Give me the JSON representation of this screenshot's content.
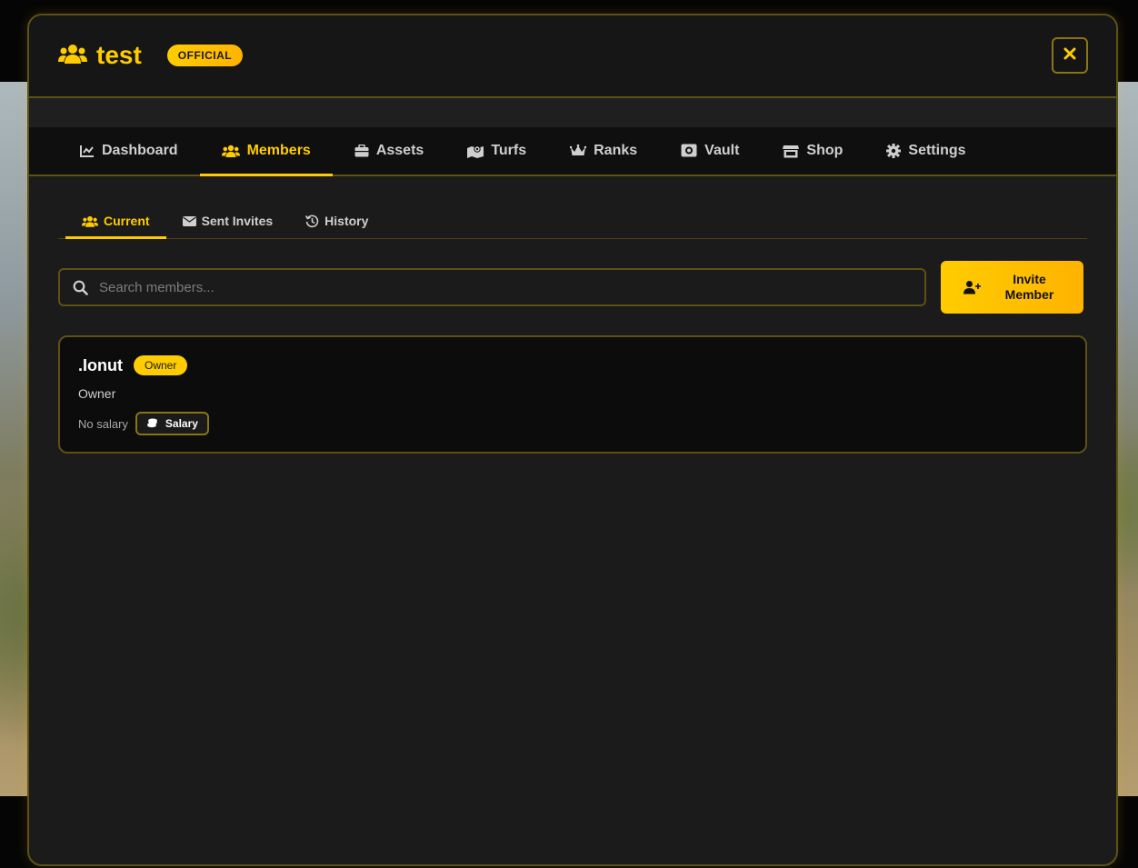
{
  "header": {
    "title": "test",
    "badge": "OFFICIAL",
    "close_label": "✕"
  },
  "tabs": [
    {
      "label": "Dashboard",
      "icon": "chart-line-icon",
      "active": false
    },
    {
      "label": "Members",
      "icon": "users-icon",
      "active": true
    },
    {
      "label": "Assets",
      "icon": "briefcase-icon",
      "active": false
    },
    {
      "label": "Turfs",
      "icon": "map-icon",
      "active": false
    },
    {
      "label": "Ranks",
      "icon": "crown-icon",
      "active": false
    },
    {
      "label": "Vault",
      "icon": "vault-icon",
      "active": false
    },
    {
      "label": "Shop",
      "icon": "store-icon",
      "active": false
    },
    {
      "label": "Settings",
      "icon": "gear-icon",
      "active": false
    }
  ],
  "subtabs": [
    {
      "label": "Current",
      "icon": "users-icon",
      "active": true
    },
    {
      "label": "Sent Invites",
      "icon": "envelope-icon",
      "active": false
    },
    {
      "label": "History",
      "icon": "history-icon",
      "active": false
    }
  ],
  "search": {
    "placeholder": "Search members..."
  },
  "invite_button": {
    "line1": "Invite",
    "line2": "Member"
  },
  "members": [
    {
      "name": ".Ionut",
      "badge": "Owner",
      "rank": "Owner",
      "salary_text": "No salary",
      "salary_button": "Salary"
    }
  ],
  "colors": {
    "accent": "#ffcc00",
    "border": "#5e5114",
    "panel_bg": "#1b1b1b"
  }
}
